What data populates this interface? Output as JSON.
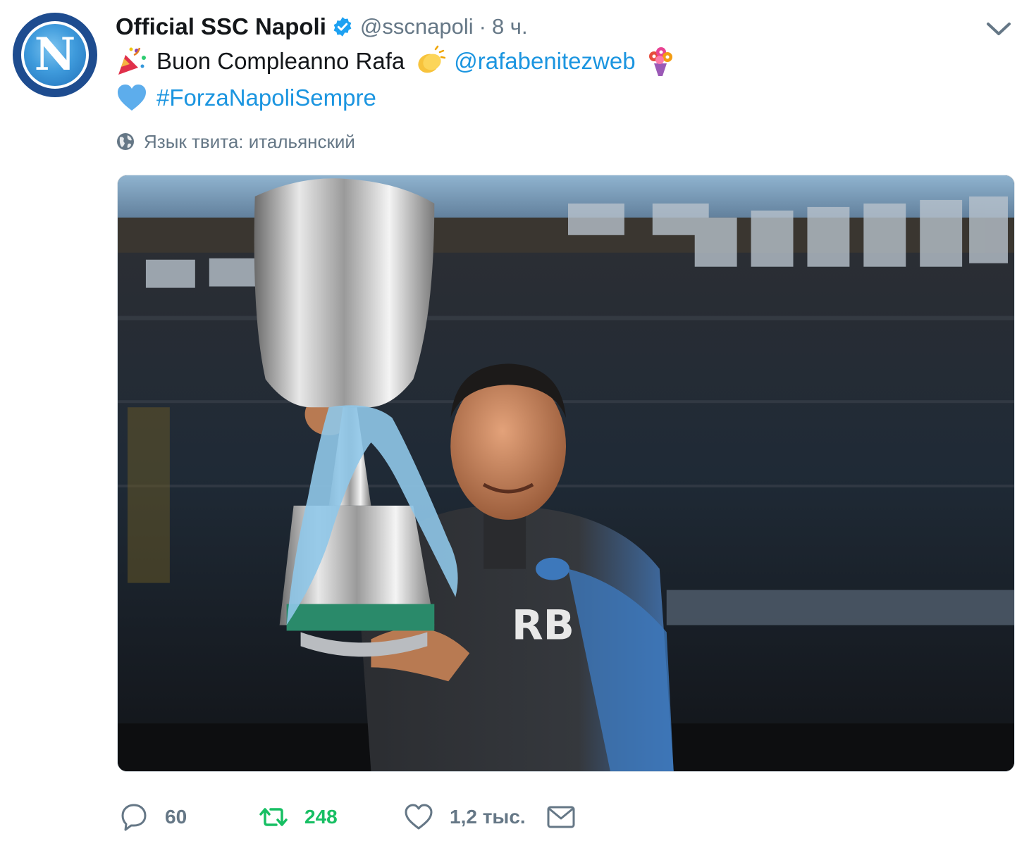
{
  "tweet": {
    "display_name": "Official SSC Napoli",
    "handle": "@sscnapoli",
    "separator": "·",
    "time": "8 ч.",
    "avatar_letter": "N",
    "line1_text": "Buon Compleanno Rafa",
    "mention": "@rafabenitezweb",
    "hashtag": "#ForzaNapoliSempre",
    "emojis": [
      "party-popper",
      "clapping-hands",
      "bouquet",
      "blue-heart"
    ],
    "language_note": "Язык твита: итальянский",
    "media_alt": "photo"
  },
  "actions": {
    "reply_count": "60",
    "retweet_count": "248",
    "like_count": "1,2 тыс."
  },
  "colors": {
    "link": "#1b95e0",
    "retweet": "#17bf63",
    "muted": "#657786",
    "verified": "#1da1f2"
  }
}
